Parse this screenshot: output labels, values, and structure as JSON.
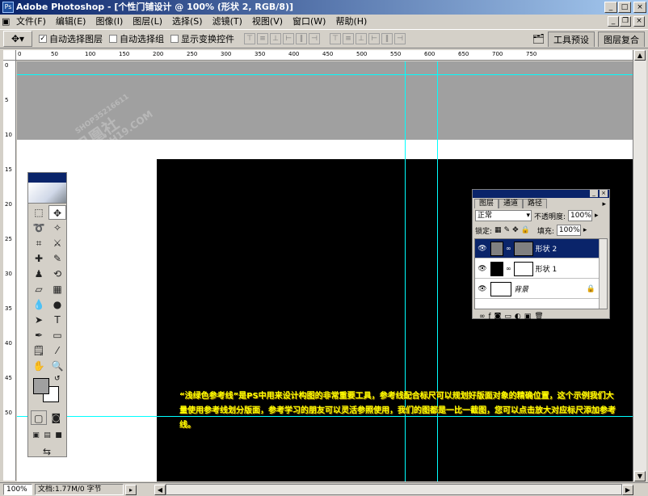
{
  "window": {
    "title": "Adobe Photoshop - [个性门铺设计 @ 100% (形状 2, RGB/8)]",
    "controls": {
      "minimize": "_",
      "maximize": "□",
      "close": "×"
    }
  },
  "menu": [
    "文件(F)",
    "编辑(E)",
    "图像(I)",
    "图层(L)",
    "选择(S)",
    "滤镜(T)",
    "视图(V)",
    "窗口(W)",
    "帮助(H)"
  ],
  "options": {
    "auto_select_layer": "自动选择图层",
    "auto_select_group": "自动选择组",
    "show_transform": "显示变换控件",
    "tabs": [
      "工具预设",
      "图层复合"
    ]
  },
  "rulers": {
    "h": [
      "0",
      "50",
      "100",
      "150",
      "200",
      "250",
      "300",
      "350",
      "400",
      "450",
      "500",
      "550",
      "600",
      "650",
      "700",
      "750"
    ],
    "v": [
      "0",
      "5",
      "10",
      "15",
      "20",
      "25",
      "30",
      "35",
      "40",
      "45",
      "50"
    ]
  },
  "layers_panel": {
    "tabs": [
      "图层",
      "通道",
      "路径"
    ],
    "blend_mode": "正常",
    "opacity_label": "不透明度:",
    "opacity_value": "100%",
    "lock_label": "锁定:",
    "fill_label": "填充:",
    "fill_value": "100%",
    "layers": [
      {
        "name": "形状 2",
        "selected": true
      },
      {
        "name": "形状 1",
        "selected": false
      },
      {
        "name": "背景",
        "selected": false
      }
    ]
  },
  "annotation": {
    "text": "“浅绿色参考线”是PS中用来设计构图的非常重要工具，参考线配合标尺可以规划好版面对象的精确位置，这个示例我们大量使用参考线划分版面，参考学习的朋友可以灵活参照使用，我们的图都是一比一截图，您可以点击放大对应标尺添加参考线。"
  },
  "watermark": {
    "line1": "SHOP35216611",
    "line2": "凤凰社",
    "line3": "WWW.FH19.COM"
  },
  "status": {
    "zoom": "100%",
    "doc_info": "文档:1.77M/0 字节"
  },
  "colors": {
    "guide": "#00ffff",
    "titlebar": "#0a246a",
    "annotation": "#ffff00"
  }
}
